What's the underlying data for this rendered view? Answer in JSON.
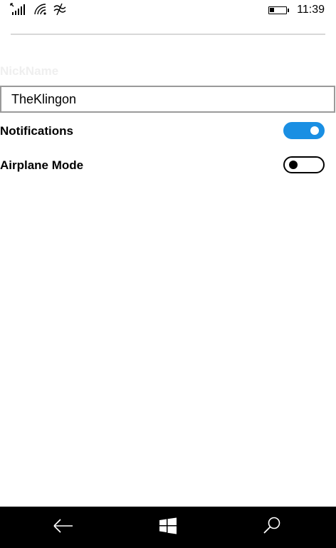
{
  "status_bar": {
    "time": "11:39",
    "icons": [
      "signal-icon",
      "wifi-icon",
      "data-sense-icon",
      "battery-icon"
    ],
    "battery_level": 0.3
  },
  "form": {
    "nickname_label": "NickName",
    "nickname_value": "TheKlingon",
    "settings": [
      {
        "label": "Notifications",
        "on": true
      },
      {
        "label": "Airplane Mode",
        "on": false
      }
    ]
  },
  "nav_bar": {
    "buttons": [
      "back-icon",
      "windows-start-icon",
      "search-icon"
    ]
  },
  "colors": {
    "accent": "#1a8fe3",
    "nav_background": "#000000",
    "label_faint": "#efefef"
  }
}
